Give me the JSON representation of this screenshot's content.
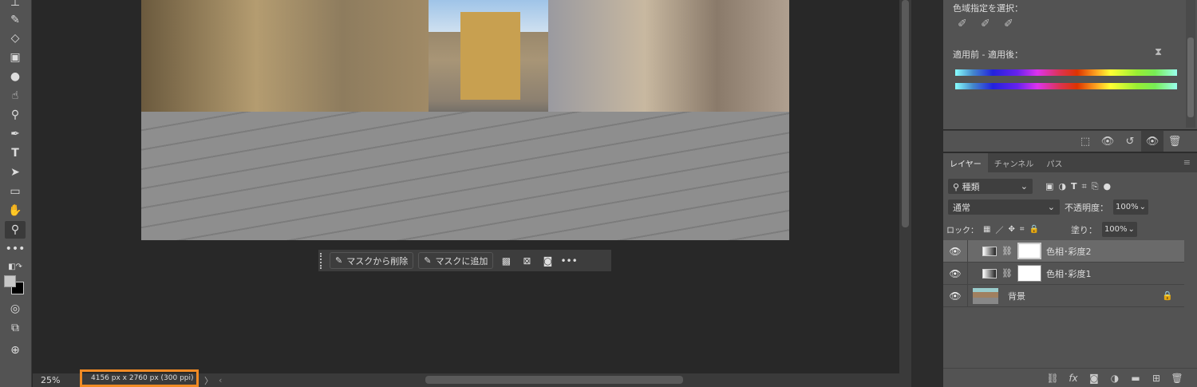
{
  "toolbar": {
    "tools": [
      "stamp",
      "healing-brush",
      "eraser",
      "gradient",
      "blur",
      "smudge",
      "dodge",
      "pen",
      "type",
      "path-select",
      "rectangle",
      "hand",
      "zoom",
      "more"
    ],
    "more": "•••"
  },
  "canvas": {
    "task_bar": {
      "remove_mask": "マスクから削除",
      "add_mask": "マスクに追加",
      "more": "•••"
    }
  },
  "status": {
    "zoom": "25%",
    "doc_info": "4156 px x 2760 px (300 ppi)",
    "arrow": "〉",
    "left": "‹"
  },
  "properties": {
    "color_range_label": "色域指定を選択：",
    "before_after_label": "適用前 - 適用後："
  },
  "layers_panel": {
    "tabs": [
      "レイヤー",
      "チャンネル",
      "パス"
    ],
    "filter": "種類",
    "blend_mode": "通常",
    "opacity_label": "不透明度：",
    "opacity": "100%",
    "lock_label": "ロック：",
    "fill_label": "塗り：",
    "fill": "100%",
    "layers": [
      {
        "name": "色相･彩度2",
        "type": "adjustment",
        "active": true
      },
      {
        "name": "色相･彩度1",
        "type": "adjustment",
        "active": false
      },
      {
        "name": "背景",
        "type": "image",
        "locked": true
      }
    ]
  },
  "colors": {
    "highlight": "#f08a24",
    "panel": "#535353",
    "canvas": "#282828"
  }
}
